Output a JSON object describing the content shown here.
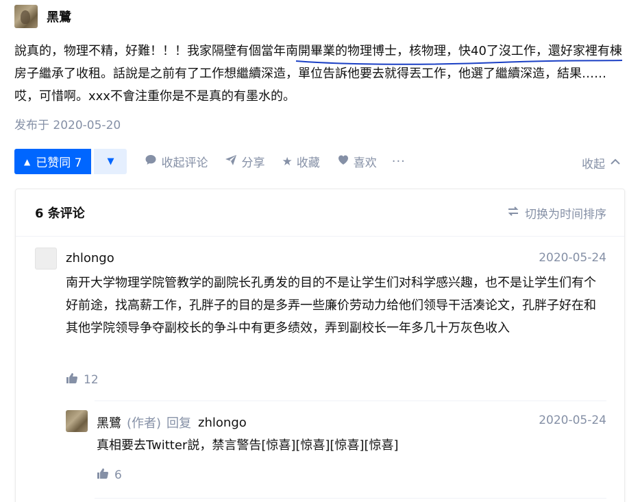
{
  "answer": {
    "author_name": "黑鷺",
    "text_part1": "說真的，物理不精，好難！！！我家隔壁有個",
    "text_underlined": "當年南開畢業的物理博士，核物理，快40了沒工作，",
    "text_part2": "還好家裡有棟房子繼承了收租。話說是之前有了工作想繼續深造，單位告訴他要去就得丟工作，他選了繼續深造，結果……哎，可惜啊。xxx不會注重你是不是真的有墨水的。",
    "publish_time": "发布于 2020-05-20",
    "underline_color": "#1a3fc4"
  },
  "actions": {
    "vote_label": "已赞同 7",
    "collapse_comments": "收起评论",
    "share": "分享",
    "favorite": "收藏",
    "like": "喜欢",
    "more": "···",
    "collapse": "收起",
    "accent_color": "#0066ff"
  },
  "comments": {
    "count_label": "6 条评论",
    "sort_label": "切换为时间排序",
    "items": [
      {
        "name": "zhlongo",
        "date": "2020-05-24",
        "text": "南开大学物理学院管教学的副院长孔勇发的目的不是让学生们对科学感兴趣，也不是让学生们有个好前途，找高薪工作，孔胖子的目的是多弄一些廉价劳动力给他们领导干活凑论文，孔胖子好在和其他学院领导争夺副校长的争斗中有更多绩效，弄到副校长一年多几十万灰色收入",
        "likes": "12"
      }
    ],
    "reply": {
      "name": "黑鷺",
      "role": "(作者)",
      "reply_word": "回复",
      "target": "zhlongo",
      "date": "2020-05-24",
      "text": "真相要去Twitter説，禁言警告[惊喜][惊喜][惊喜][惊喜]",
      "likes": "6"
    }
  }
}
